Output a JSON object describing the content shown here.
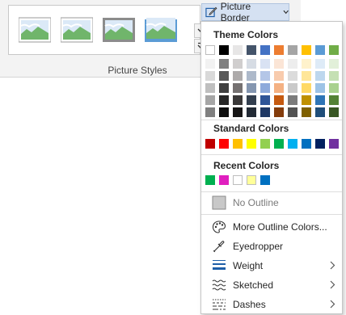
{
  "ribbon": {
    "group_label": "Picture Styles",
    "thumbnails": [
      "picture-style-1",
      "picture-style-2",
      "picture-style-3",
      "picture-style-4"
    ]
  },
  "picture_border": {
    "label": "Picture Border"
  },
  "menu": {
    "theme_colors_heading": "Theme Colors",
    "theme_top_row": [
      "#ffffff",
      "#000000",
      "#e7e6e6",
      "#44546a",
      "#4472c4",
      "#ed7d31",
      "#a5a5a5",
      "#ffc000",
      "#5b9bd5",
      "#70ad47"
    ],
    "theme_columns": [
      [
        "#f2f2f2",
        "#d9d9d9",
        "#bfbfbf",
        "#a6a6a6",
        "#808080"
      ],
      [
        "#808080",
        "#595959",
        "#404040",
        "#262626",
        "#0d0d0d"
      ],
      [
        "#d0cece",
        "#aeabab",
        "#757171",
        "#3a3838",
        "#171616"
      ],
      [
        "#d6dce4",
        "#adb9ca",
        "#8496b0",
        "#333f4f",
        "#222a35"
      ],
      [
        "#d9e2f3",
        "#b4c6e7",
        "#8eaadb",
        "#2f5597",
        "#1f3864"
      ],
      [
        "#fbe5d6",
        "#f8cbad",
        "#f4b183",
        "#c55a11",
        "#843c0c"
      ],
      [
        "#ededed",
        "#dbdbdb",
        "#c9c9c9",
        "#7b7b7b",
        "#525252"
      ],
      [
        "#fff2cc",
        "#ffe699",
        "#ffd966",
        "#bf9000",
        "#7f6000"
      ],
      [
        "#deebf7",
        "#bdd7ee",
        "#9dc3e6",
        "#2e75b6",
        "#1f4e79"
      ],
      [
        "#e2f0d9",
        "#c5e0b4",
        "#a9d18e",
        "#548235",
        "#385723"
      ]
    ],
    "standard_colors_heading": "Standard Colors",
    "standard_colors": [
      "#c00000",
      "#ff0000",
      "#ffc000",
      "#ffff00",
      "#92d050",
      "#00b050",
      "#00b0f0",
      "#0070c0",
      "#002060",
      "#7030a0"
    ],
    "recent_colors_heading": "Recent Colors",
    "recent_colors": [
      "#00b050",
      "#e01fbf",
      "#ffffff",
      "#ffff99",
      "#0070c0"
    ],
    "no_outline": "No Outline",
    "more_outline_colors": "More Outline Colors...",
    "eyedropper": "Eyedropper",
    "weight": "Weight",
    "sketched": "Sketched",
    "dashes": "Dashes"
  }
}
